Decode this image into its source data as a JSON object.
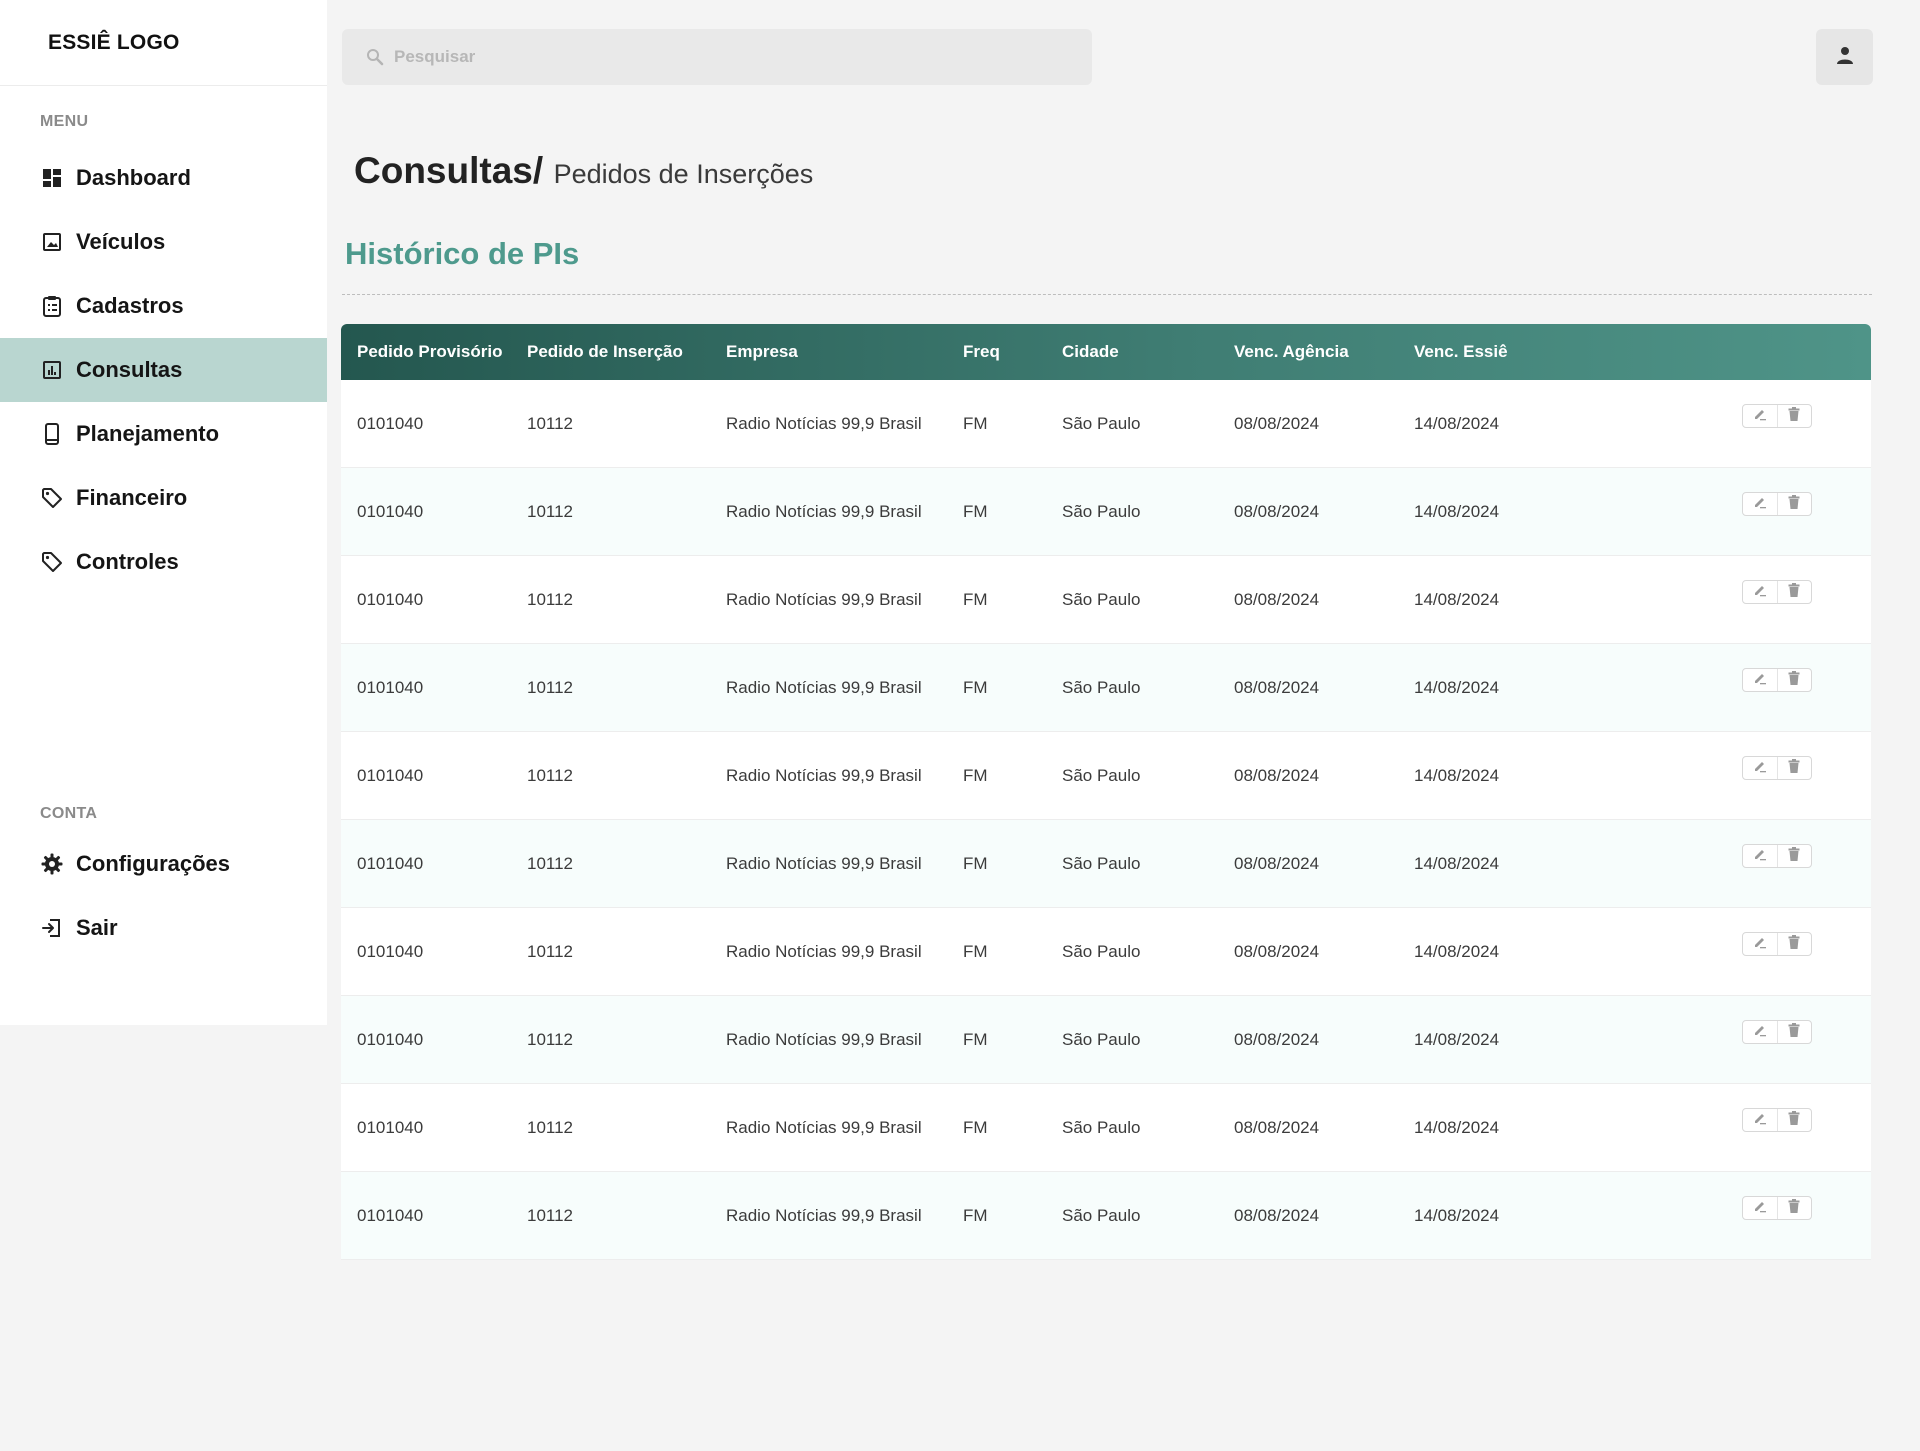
{
  "sidebar": {
    "logo": "ESSIÊ LOGO",
    "menu_label": "MENU",
    "menu_items": [
      {
        "label": "Dashboard",
        "icon": "dashboard-icon"
      },
      {
        "label": "Veículos",
        "icon": "image-icon"
      },
      {
        "label": "Cadastros",
        "icon": "clipboard-icon"
      },
      {
        "label": "Consultas",
        "icon": "chart-icon",
        "active": true
      },
      {
        "label": "Planejamento",
        "icon": "phone-icon"
      },
      {
        "label": "Financeiro",
        "icon": "tag-icon"
      },
      {
        "label": "Controles",
        "icon": "tag-icon"
      }
    ],
    "account_label": "CONTA",
    "account_items": [
      {
        "label": "Configurações",
        "icon": "gear-icon"
      },
      {
        "label": "Sair",
        "icon": "logout-icon"
      }
    ]
  },
  "header": {
    "search_placeholder": "Pesquisar",
    "user_icon": "user-icon"
  },
  "page": {
    "title": "Consultas/",
    "subtitle": "Pedidos de Inserções",
    "section_title": "Histórico de PIs"
  },
  "table": {
    "columns": [
      "Pedido Provisório",
      "Pedido de Inserção",
      "Empresa",
      "Freq",
      "Cidade",
      "Venc. Agência",
      "Venc. Essiê"
    ],
    "rows": [
      [
        "0101040",
        "10112",
        "Radio Notícias 99,9 Brasil",
        "FM",
        "São Paulo",
        "08/08/2024",
        "14/08/2024"
      ],
      [
        "0101040",
        "10112",
        "Radio Notícias 99,9 Brasil",
        "FM",
        "São Paulo",
        "08/08/2024",
        "14/08/2024"
      ],
      [
        "0101040",
        "10112",
        "Radio Notícias 99,9 Brasil",
        "FM",
        "São Paulo",
        "08/08/2024",
        "14/08/2024"
      ],
      [
        "0101040",
        "10112",
        "Radio Notícias 99,9 Brasil",
        "FM",
        "São Paulo",
        "08/08/2024",
        "14/08/2024"
      ],
      [
        "0101040",
        "10112",
        "Radio Notícias 99,9 Brasil",
        "FM",
        "São Paulo",
        "08/08/2024",
        "14/08/2024"
      ],
      [
        "0101040",
        "10112",
        "Radio Notícias 99,9 Brasil",
        "FM",
        "São Paulo",
        "08/08/2024",
        "14/08/2024"
      ],
      [
        "0101040",
        "10112",
        "Radio Notícias 99,9 Brasil",
        "FM",
        "São Paulo",
        "08/08/2024",
        "14/08/2024"
      ],
      [
        "0101040",
        "10112",
        "Radio Notícias 99,9 Brasil",
        "FM",
        "São Paulo",
        "08/08/2024",
        "14/08/2024"
      ],
      [
        "0101040",
        "10112",
        "Radio Notícias 99,9 Brasil",
        "FM",
        "São Paulo",
        "08/08/2024",
        "14/08/2024"
      ],
      [
        "0101040",
        "10112",
        "Radio Notícias 99,9 Brasil",
        "FM",
        "São Paulo",
        "08/08/2024",
        "14/08/2024"
      ]
    ],
    "row_actions": [
      "edit-icon",
      "trash-icon"
    ]
  },
  "colors": {
    "accent": "#4e9a8d",
    "active_menu_bg": "#b9d6d0",
    "header_dark": "#24574f",
    "header_light": "#4f9488"
  }
}
